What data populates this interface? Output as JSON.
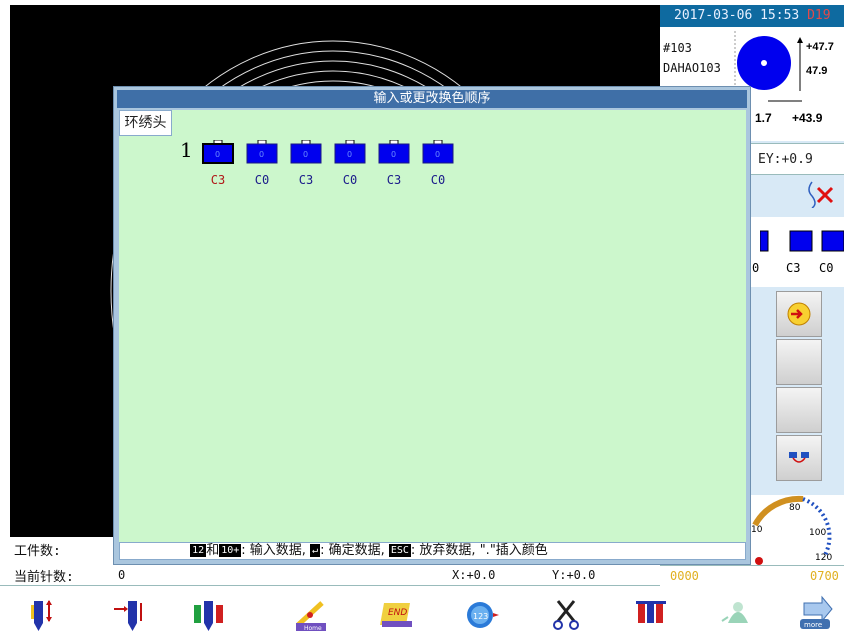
{
  "right_panel": {
    "datetime": "2017-03-06 15:53",
    "datetime_tail": "D19",
    "pattern_no": "#103",
    "pattern_name": "DAHAO103",
    "dim_top": "+47.7",
    "dim_right": "47.9",
    "dim_left": "1.7",
    "dim_bottom": "+43.9",
    "ey": "EY:+0.9",
    "color_labels": [
      "0",
      "C3",
      "C0"
    ],
    "speed_ticks": [
      "80",
      "10",
      "100",
      "120"
    ],
    "counter_left": "0000",
    "counter_right": "0700"
  },
  "status": {
    "workpiece_label": "工件数:",
    "stitch_label": "当前针数:",
    "stitch_value": "0",
    "x_coord": "X:+0.0",
    "y_coord": "Y:+0.0"
  },
  "dialog": {
    "title": "输入或更改换色顺序",
    "tab_label": "环绣头",
    "row_index": "1",
    "spools": [
      {
        "label": "C3",
        "selected": true
      },
      {
        "label": "C0",
        "selected": false
      },
      {
        "label": "C3",
        "selected": false
      },
      {
        "label": "C0",
        "selected": false
      },
      {
        "label": "C3",
        "selected": false
      },
      {
        "label": "C0",
        "selected": false
      }
    ],
    "help": {
      "key1": "12",
      "join": "和",
      "key2": "10+",
      "part1": ": 输入数据, ",
      "key3": "↵",
      "part2": ": 确定数据, ",
      "key4": "ESC",
      "part3": ": 放弃数据, ",
      "part4": "\".\"插入颜色"
    }
  },
  "toolbar": {
    "items": [
      "needle-updown-icon",
      "frame-move-icon",
      "color-change-icon",
      "home-icon",
      "end-icon",
      "speed-icon",
      "scissors-icon",
      "multi-needle-icon",
      "head-icon",
      "more-icon"
    ],
    "end_text": "END",
    "home_text": "Home",
    "more_text": "more",
    "speed_text": "123"
  },
  "colors": {
    "accent": "#0e6aa0",
    "dialog_bg": "#ccf7cc",
    "spool_blue": "#0000ee",
    "selected_label": "#b01818"
  }
}
